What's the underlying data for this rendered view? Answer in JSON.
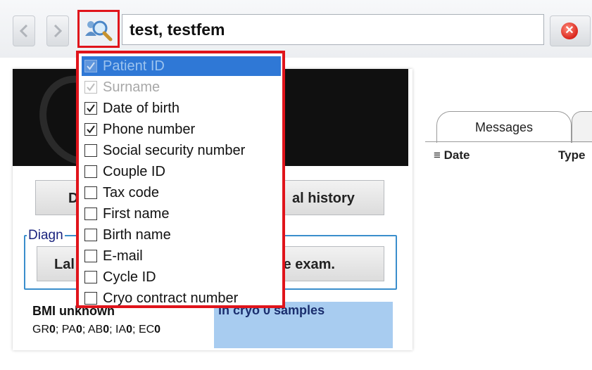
{
  "toolbar": {
    "search_query": "test, testfem",
    "back_icon": "back-arrow-icon",
    "forward_icon": "forward-arrow-icon",
    "search_icon": "magnifier-people-icon",
    "clear_icon": "clear-x-icon",
    "clear_symbol": "✕"
  },
  "search_fields_menu": {
    "items": [
      {
        "label": "Patient ID",
        "checked": true,
        "state": "selected-disabled"
      },
      {
        "label": "Surname",
        "checked": true,
        "state": "disabled"
      },
      {
        "label": "Date of birth",
        "checked": true,
        "state": "normal"
      },
      {
        "label": "Phone number",
        "checked": true,
        "state": "normal"
      },
      {
        "label": "Social security number",
        "checked": false,
        "state": "normal"
      },
      {
        "label": "Couple ID",
        "checked": false,
        "state": "normal"
      },
      {
        "label": "Tax code",
        "checked": false,
        "state": "normal"
      },
      {
        "label": "First name",
        "checked": false,
        "state": "normal"
      },
      {
        "label": "Birth name",
        "checked": false,
        "state": "normal"
      },
      {
        "label": "E-mail",
        "checked": false,
        "state": "normal"
      },
      {
        "label": "Cycle ID",
        "checked": false,
        "state": "normal"
      },
      {
        "label": "Cryo contract number",
        "checked": false,
        "state": "normal"
      }
    ]
  },
  "patient_panel": {
    "button1_label": "De",
    "button2_label": "al history",
    "diagnostics_legend": "Diagn",
    "button3_label": "Lal",
    "button4_label": "le exam.",
    "bmi_text": "BMI unknown",
    "codes": [
      {
        "code": "GR",
        "value": "0"
      },
      {
        "code": "PA",
        "value": "0"
      },
      {
        "code": "AB",
        "value": "0"
      },
      {
        "code": "IA",
        "value": "0"
      },
      {
        "code": "EC",
        "value": "0"
      }
    ],
    "cryo_text": "in cryo 0 samples"
  },
  "messages": {
    "tab_label": "Messages",
    "col_date": "Date",
    "col_type": "Type"
  },
  "colors": {
    "highlight_border": "#e0141b",
    "selected_row": "#2f78d6",
    "cryo_box": "#a8ccf0"
  }
}
